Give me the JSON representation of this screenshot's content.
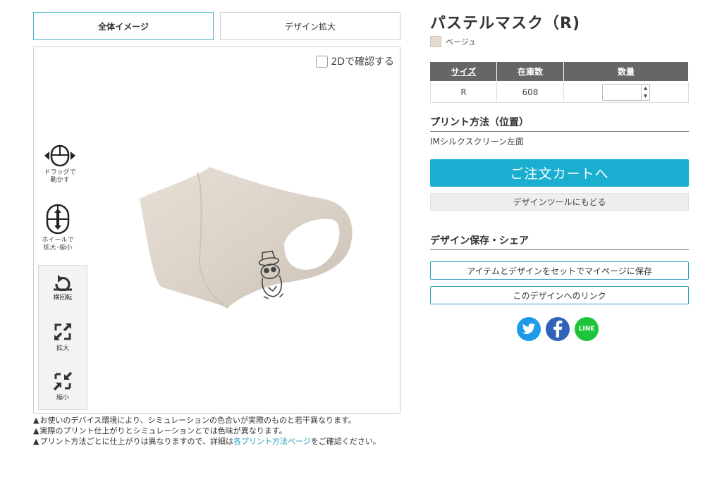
{
  "tabs": {
    "overview": "全体イメージ",
    "zoom": "デザイン拡大"
  },
  "viewer": {
    "check_2d": "2Dで確認する",
    "drag_hint": "ドラッグで\n動かす",
    "drag_hint_1": "ドラッグで",
    "drag_hint_2": "動かす",
    "wheel_hint_1": "ホイールで",
    "wheel_hint_2": "拡大･縮小",
    "rotate_label": "横回転",
    "zoom_in_label": "拡大",
    "zoom_out_label": "縮小",
    "mask_color": "#ddd4ca",
    "icons": [
      "mouse-drag-icon",
      "mouse-wheel-icon",
      "rotate-icon",
      "expand-icon",
      "shrink-icon"
    ]
  },
  "notes": {
    "note1": "お使いのデバイス環境により、シミュレーションの色合いが実際のものと若干異なります。",
    "note2": "実際のプリント仕上がりとシミュレーションとでは色味が異なります。",
    "note3_before": "プリント方法ごとに仕上がりは異なりますので、詳細は",
    "note3_link": "各プリント方法ページ",
    "note3_after": "をご確認ください。"
  },
  "product": {
    "title": "パステルマスク（R)",
    "color_name": "ベージュ",
    "color_hex": "#e5dbd0"
  },
  "stock_table": {
    "headers": {
      "size": "サイズ",
      "stock": "在庫数",
      "quantity": "数量"
    },
    "rows": [
      {
        "size": "R",
        "stock": "608",
        "quantity": ""
      }
    ]
  },
  "print": {
    "section_title": "プリント方法（位置）",
    "method": "IMシルクスクリーン左面"
  },
  "actions": {
    "order": "ご注文カートへ",
    "back": "デザインツールにもどる"
  },
  "save_share": {
    "section_title": "デザイン保存・シェア",
    "save_mypage": "アイテムとデザインをセットでマイページに保存",
    "design_link": "このデザインへのリンク"
  },
  "social": {
    "twitter_color": "#1d9be8",
    "facebook_color": "#2f62b8",
    "line_color": "#1fc43a",
    "line_label": "LINE"
  },
  "colors": {
    "accent": "#1aafd0",
    "table_header": "#666666"
  }
}
